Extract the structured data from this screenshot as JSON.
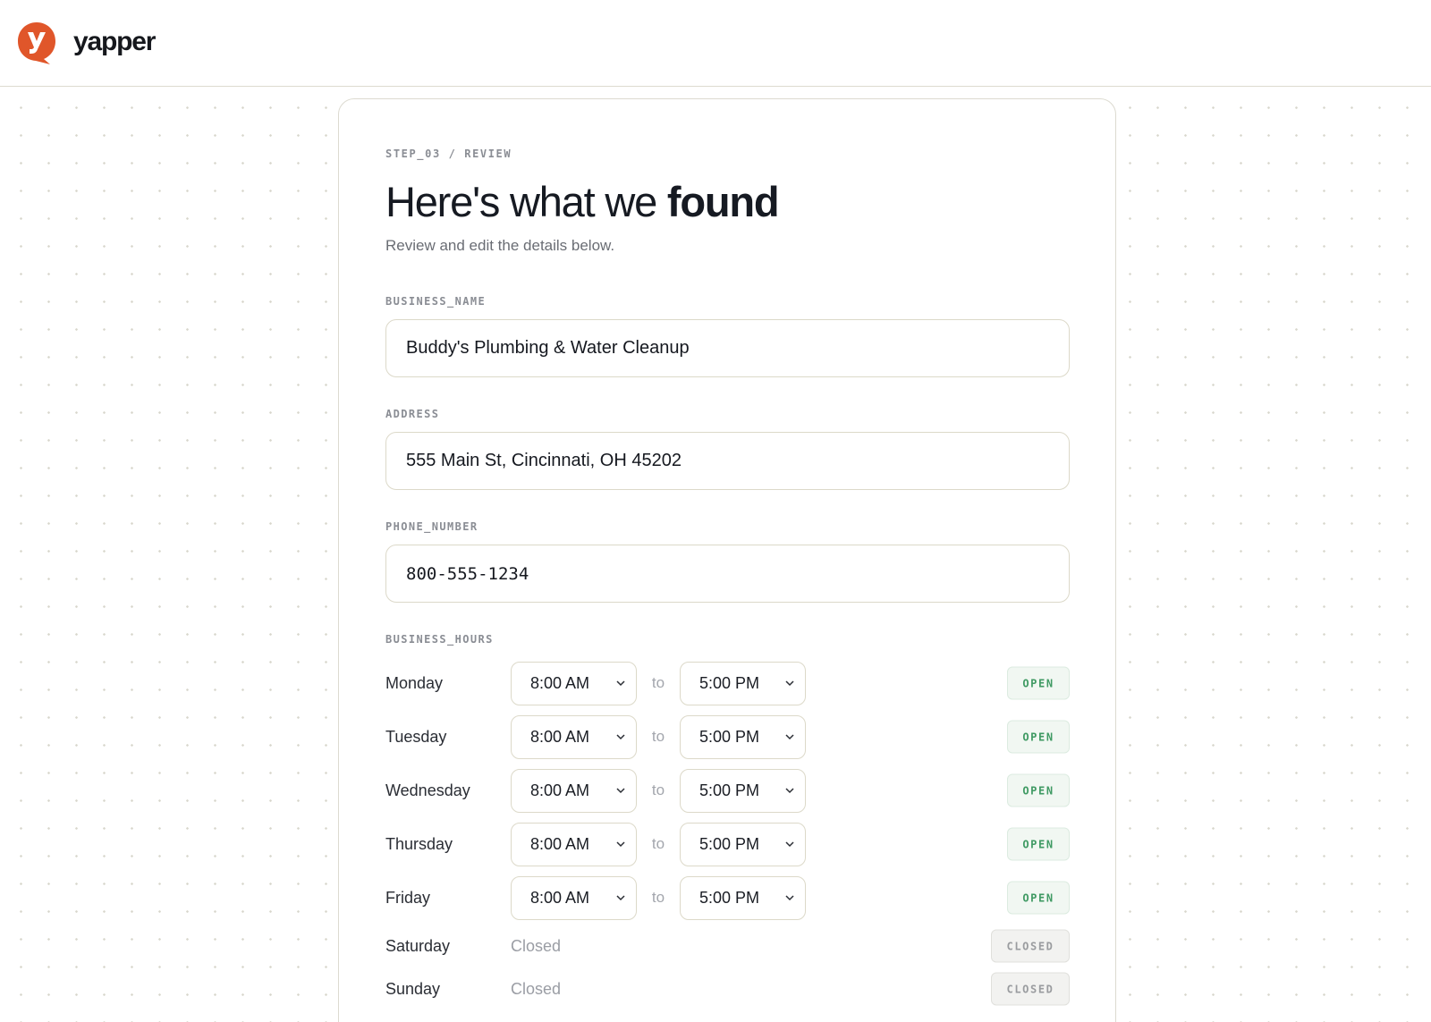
{
  "brand": {
    "name": "yapper",
    "accent": "#e0562a"
  },
  "step": "STEP_03 / REVIEW",
  "title": {
    "regular": "Here's what we ",
    "bold": "found"
  },
  "subtitle": "Review and edit the details below.",
  "fields": {
    "business_name": {
      "label": "BUSINESS_NAME",
      "value": "Buddy's Plumbing & Water Cleanup"
    },
    "address": {
      "label": "ADDRESS",
      "value": "555 Main St, Cincinnati, OH 45202"
    },
    "phone": {
      "label": "PHONE_NUMBER",
      "value": "800-555-1234"
    }
  },
  "hours": {
    "label": "BUSINESS_HOURS",
    "separator": "to",
    "days": [
      {
        "day": "Monday",
        "open": "8:00 AM",
        "close": "5:00 PM",
        "status": "OPEN"
      },
      {
        "day": "Tuesday",
        "open": "8:00 AM",
        "close": "5:00 PM",
        "status": "OPEN"
      },
      {
        "day": "Wednesday",
        "open": "8:00 AM",
        "close": "5:00 PM",
        "status": "OPEN"
      },
      {
        "day": "Thursday",
        "open": "8:00 AM",
        "close": "5:00 PM",
        "status": "OPEN"
      },
      {
        "day": "Friday",
        "open": "8:00 AM",
        "close": "5:00 PM",
        "status": "OPEN"
      },
      {
        "day": "Saturday",
        "closed_text": "Closed",
        "status": "CLOSED"
      },
      {
        "day": "Sunday",
        "closed_text": "Closed",
        "status": "CLOSED"
      }
    ]
  }
}
